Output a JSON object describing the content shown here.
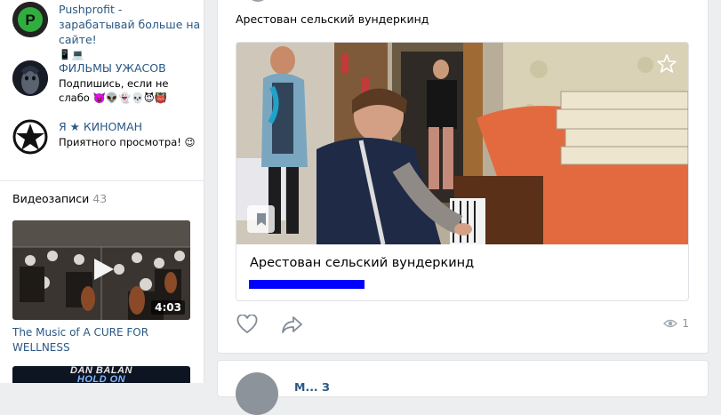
{
  "sidebar": {
    "groups": [
      {
        "name": "Pushprofit - зарабатывай больше на сайте!",
        "subtitle": "📱💻"
      },
      {
        "name": "ФИЛЬМЫ УЖАСОВ",
        "subtitle": "Подпишись, если не слабо 👿👽👻💀😈👹"
      },
      {
        "name": "Я ★ КИНОМАН",
        "subtitle": "Приятного просмотра! 😉"
      }
    ],
    "videos": {
      "heading": "Видеозаписи",
      "count": "43",
      "items": [
        {
          "duration": "4:03",
          "title": "The Music of A CURE FOR WELLNESS"
        },
        {
          "overlay_line1": "DAN BALAN",
          "overlay_line2": "HOLD ON"
        }
      ]
    }
  },
  "post": {
    "text": "Арестован сельский вундеркинд",
    "link_title": "Арестован сельский вундеркинд",
    "views": "1",
    "icons": {
      "like": "heart-icon",
      "share": "share-arrow-icon",
      "views": "eye-icon",
      "fave": "star-icon",
      "bookmark": "bookmark-icon"
    }
  },
  "next_post": {
    "author_partial": "М...   З"
  },
  "colors": {
    "link": "#2a5885",
    "background": "#edeef0",
    "url_redaction": "#0000ff"
  }
}
